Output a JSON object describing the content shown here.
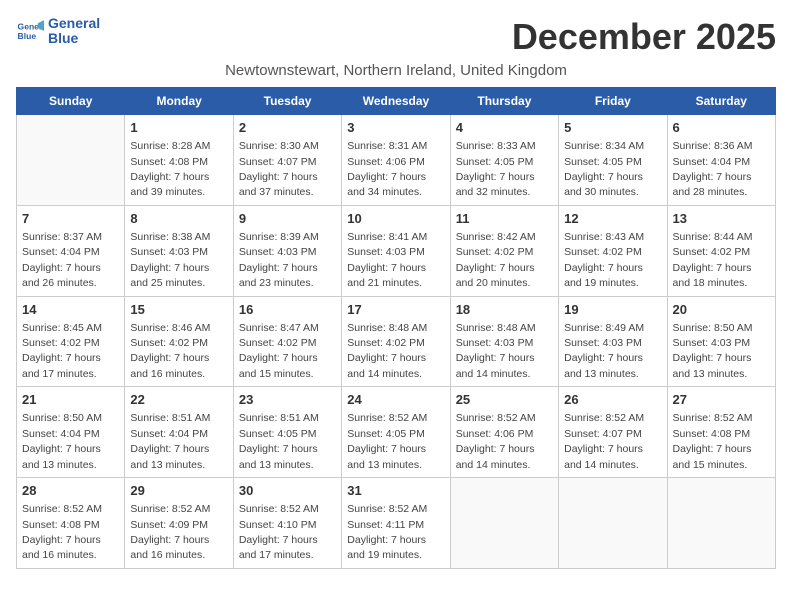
{
  "header": {
    "logo_line1": "General",
    "logo_line2": "Blue",
    "month_title": "December 2025",
    "subtitle": "Newtownstewart, Northern Ireland, United Kingdom"
  },
  "days_of_week": [
    "Sunday",
    "Monday",
    "Tuesday",
    "Wednesday",
    "Thursday",
    "Friday",
    "Saturday"
  ],
  "weeks": [
    [
      {
        "num": "",
        "sunrise": "",
        "sunset": "",
        "daylight": "",
        "empty": true
      },
      {
        "num": "1",
        "sunrise": "Sunrise: 8:28 AM",
        "sunset": "Sunset: 4:08 PM",
        "daylight": "Daylight: 7 hours and 39 minutes."
      },
      {
        "num": "2",
        "sunrise": "Sunrise: 8:30 AM",
        "sunset": "Sunset: 4:07 PM",
        "daylight": "Daylight: 7 hours and 37 minutes."
      },
      {
        "num": "3",
        "sunrise": "Sunrise: 8:31 AM",
        "sunset": "Sunset: 4:06 PM",
        "daylight": "Daylight: 7 hours and 34 minutes."
      },
      {
        "num": "4",
        "sunrise": "Sunrise: 8:33 AM",
        "sunset": "Sunset: 4:05 PM",
        "daylight": "Daylight: 7 hours and 32 minutes."
      },
      {
        "num": "5",
        "sunrise": "Sunrise: 8:34 AM",
        "sunset": "Sunset: 4:05 PM",
        "daylight": "Daylight: 7 hours and 30 minutes."
      },
      {
        "num": "6",
        "sunrise": "Sunrise: 8:36 AM",
        "sunset": "Sunset: 4:04 PM",
        "daylight": "Daylight: 7 hours and 28 minutes."
      }
    ],
    [
      {
        "num": "7",
        "sunrise": "Sunrise: 8:37 AM",
        "sunset": "Sunset: 4:04 PM",
        "daylight": "Daylight: 7 hours and 26 minutes."
      },
      {
        "num": "8",
        "sunrise": "Sunrise: 8:38 AM",
        "sunset": "Sunset: 4:03 PM",
        "daylight": "Daylight: 7 hours and 25 minutes."
      },
      {
        "num": "9",
        "sunrise": "Sunrise: 8:39 AM",
        "sunset": "Sunset: 4:03 PM",
        "daylight": "Daylight: 7 hours and 23 minutes."
      },
      {
        "num": "10",
        "sunrise": "Sunrise: 8:41 AM",
        "sunset": "Sunset: 4:03 PM",
        "daylight": "Daylight: 7 hours and 21 minutes."
      },
      {
        "num": "11",
        "sunrise": "Sunrise: 8:42 AM",
        "sunset": "Sunset: 4:02 PM",
        "daylight": "Daylight: 7 hours and 20 minutes."
      },
      {
        "num": "12",
        "sunrise": "Sunrise: 8:43 AM",
        "sunset": "Sunset: 4:02 PM",
        "daylight": "Daylight: 7 hours and 19 minutes."
      },
      {
        "num": "13",
        "sunrise": "Sunrise: 8:44 AM",
        "sunset": "Sunset: 4:02 PM",
        "daylight": "Daylight: 7 hours and 18 minutes."
      }
    ],
    [
      {
        "num": "14",
        "sunrise": "Sunrise: 8:45 AM",
        "sunset": "Sunset: 4:02 PM",
        "daylight": "Daylight: 7 hours and 17 minutes."
      },
      {
        "num": "15",
        "sunrise": "Sunrise: 8:46 AM",
        "sunset": "Sunset: 4:02 PM",
        "daylight": "Daylight: 7 hours and 16 minutes."
      },
      {
        "num": "16",
        "sunrise": "Sunrise: 8:47 AM",
        "sunset": "Sunset: 4:02 PM",
        "daylight": "Daylight: 7 hours and 15 minutes."
      },
      {
        "num": "17",
        "sunrise": "Sunrise: 8:48 AM",
        "sunset": "Sunset: 4:02 PM",
        "daylight": "Daylight: 7 hours and 14 minutes."
      },
      {
        "num": "18",
        "sunrise": "Sunrise: 8:48 AM",
        "sunset": "Sunset: 4:03 PM",
        "daylight": "Daylight: 7 hours and 14 minutes."
      },
      {
        "num": "19",
        "sunrise": "Sunrise: 8:49 AM",
        "sunset": "Sunset: 4:03 PM",
        "daylight": "Daylight: 7 hours and 13 minutes."
      },
      {
        "num": "20",
        "sunrise": "Sunrise: 8:50 AM",
        "sunset": "Sunset: 4:03 PM",
        "daylight": "Daylight: 7 hours and 13 minutes."
      }
    ],
    [
      {
        "num": "21",
        "sunrise": "Sunrise: 8:50 AM",
        "sunset": "Sunset: 4:04 PM",
        "daylight": "Daylight: 7 hours and 13 minutes."
      },
      {
        "num": "22",
        "sunrise": "Sunrise: 8:51 AM",
        "sunset": "Sunset: 4:04 PM",
        "daylight": "Daylight: 7 hours and 13 minutes."
      },
      {
        "num": "23",
        "sunrise": "Sunrise: 8:51 AM",
        "sunset": "Sunset: 4:05 PM",
        "daylight": "Daylight: 7 hours and 13 minutes."
      },
      {
        "num": "24",
        "sunrise": "Sunrise: 8:52 AM",
        "sunset": "Sunset: 4:05 PM",
        "daylight": "Daylight: 7 hours and 13 minutes."
      },
      {
        "num": "25",
        "sunrise": "Sunrise: 8:52 AM",
        "sunset": "Sunset: 4:06 PM",
        "daylight": "Daylight: 7 hours and 14 minutes."
      },
      {
        "num": "26",
        "sunrise": "Sunrise: 8:52 AM",
        "sunset": "Sunset: 4:07 PM",
        "daylight": "Daylight: 7 hours and 14 minutes."
      },
      {
        "num": "27",
        "sunrise": "Sunrise: 8:52 AM",
        "sunset": "Sunset: 4:08 PM",
        "daylight": "Daylight: 7 hours and 15 minutes."
      }
    ],
    [
      {
        "num": "28",
        "sunrise": "Sunrise: 8:52 AM",
        "sunset": "Sunset: 4:08 PM",
        "daylight": "Daylight: 7 hours and 16 minutes."
      },
      {
        "num": "29",
        "sunrise": "Sunrise: 8:52 AM",
        "sunset": "Sunset: 4:09 PM",
        "daylight": "Daylight: 7 hours and 16 minutes."
      },
      {
        "num": "30",
        "sunrise": "Sunrise: 8:52 AM",
        "sunset": "Sunset: 4:10 PM",
        "daylight": "Daylight: 7 hours and 17 minutes."
      },
      {
        "num": "31",
        "sunrise": "Sunrise: 8:52 AM",
        "sunset": "Sunset: 4:11 PM",
        "daylight": "Daylight: 7 hours and 19 minutes."
      },
      {
        "num": "",
        "sunrise": "",
        "sunset": "",
        "daylight": "",
        "empty": true
      },
      {
        "num": "",
        "sunrise": "",
        "sunset": "",
        "daylight": "",
        "empty": true
      },
      {
        "num": "",
        "sunrise": "",
        "sunset": "",
        "daylight": "",
        "empty": true
      }
    ]
  ]
}
